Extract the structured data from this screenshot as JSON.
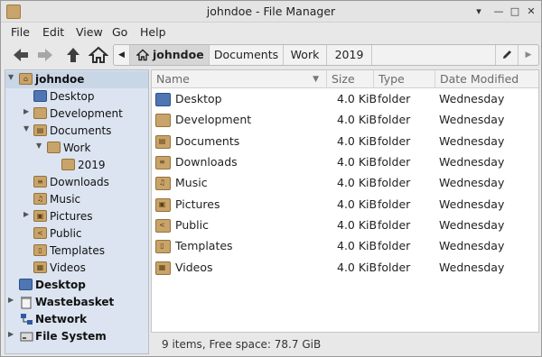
{
  "window": {
    "title": "johndoe - File Manager"
  },
  "window_buttons": {
    "menu": "▾",
    "minimize": "—",
    "maximize": "□",
    "close": "✕"
  },
  "menubar": {
    "items": [
      "File",
      "Edit",
      "View",
      "Go",
      "Help"
    ]
  },
  "pathbar": {
    "crumbs": [
      "johndoe",
      "Documents",
      "Work",
      "2019"
    ]
  },
  "sidebar": {
    "items": [
      {
        "label": "johndoe",
        "icon": "home-folder-icon",
        "expanded": true,
        "bold": true
      },
      {
        "label": "Desktop",
        "icon": "desktop-icon"
      },
      {
        "label": "Development",
        "icon": "folder-icon",
        "expandable": true
      },
      {
        "label": "Documents",
        "icon": "documents-folder-icon",
        "expanded": true
      },
      {
        "label": "Work",
        "icon": "folder-icon",
        "expanded": true
      },
      {
        "label": "2019",
        "icon": "folder-icon"
      },
      {
        "label": "Downloads",
        "icon": "downloads-folder-icon"
      },
      {
        "label": "Music",
        "icon": "music-folder-icon"
      },
      {
        "label": "Pictures",
        "icon": "pictures-folder-icon",
        "expandable": true
      },
      {
        "label": "Public",
        "icon": "public-folder-icon"
      },
      {
        "label": "Templates",
        "icon": "templates-folder-icon"
      },
      {
        "label": "Videos",
        "icon": "videos-folder-icon"
      },
      {
        "label": "Desktop",
        "icon": "desktop-icon",
        "bold": true
      },
      {
        "label": "Wastebasket",
        "icon": "trash-icon",
        "bold": true,
        "expandable": true
      },
      {
        "label": "Network",
        "icon": "network-icon",
        "bold": true
      },
      {
        "label": "File System",
        "icon": "drive-icon",
        "bold": true,
        "expandable": true
      }
    ]
  },
  "list": {
    "columns": [
      "Name",
      "Size",
      "Type",
      "Date Modified"
    ],
    "rows": [
      {
        "name": "Desktop",
        "size": "4.0 KiB",
        "type": "folder",
        "date": "Wednesday",
        "icon": "desktop-icon"
      },
      {
        "name": "Development",
        "size": "4.0 KiB",
        "type": "folder",
        "date": "Wednesday",
        "icon": "folder-icon"
      },
      {
        "name": "Documents",
        "size": "4.0 KiB",
        "type": "folder",
        "date": "Wednesday",
        "icon": "documents-folder-icon"
      },
      {
        "name": "Downloads",
        "size": "4.0 KiB",
        "type": "folder",
        "date": "Wednesday",
        "icon": "downloads-folder-icon"
      },
      {
        "name": "Music",
        "size": "4.0 KiB",
        "type": "folder",
        "date": "Wednesday",
        "icon": "music-folder-icon"
      },
      {
        "name": "Pictures",
        "size": "4.0 KiB",
        "type": "folder",
        "date": "Wednesday",
        "icon": "pictures-folder-icon"
      },
      {
        "name": "Public",
        "size": "4.0 KiB",
        "type": "folder",
        "date": "Wednesday",
        "icon": "public-folder-icon"
      },
      {
        "name": "Templates",
        "size": "4.0 KiB",
        "type": "folder",
        "date": "Wednesday",
        "icon": "templates-folder-icon"
      },
      {
        "name": "Videos",
        "size": "4.0 KiB",
        "type": "folder",
        "date": "Wednesday",
        "icon": "videos-folder-icon"
      }
    ]
  },
  "status": {
    "text": "9 items, Free space: 78.7 GiB"
  },
  "colors": {
    "sidebar_bg": "#dbe4f0",
    "folder": "#c9a46a",
    "selected": "#c9d6e6"
  }
}
